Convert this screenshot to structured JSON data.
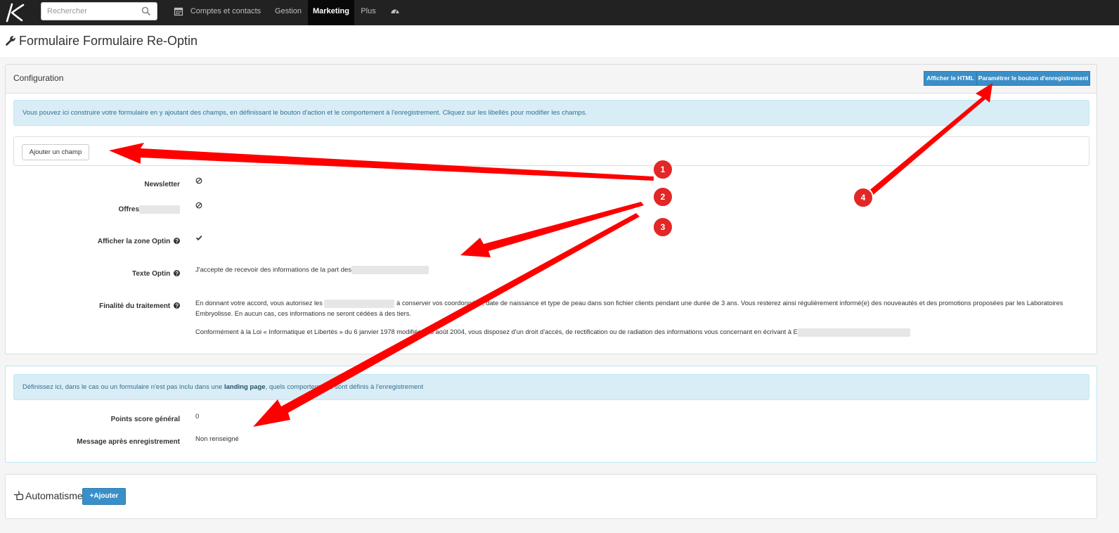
{
  "nav": {
    "search_placeholder": "Rechercher",
    "items": [
      {
        "label": "Comptes et contacts"
      },
      {
        "label": "Gestion"
      },
      {
        "label": "Marketing"
      },
      {
        "label": "Plus"
      }
    ]
  },
  "page": {
    "title": "Formulaire Formulaire Re-Optin"
  },
  "config": {
    "heading": "Configuration",
    "btn_html": "Afficher le HTML",
    "btn_param": "Paramétrer le bouton d'enregistrement",
    "info": "Vous pouvez ici construire votre formulaire en y ajoutant des champs, en définissant le bouton d'action et le comportement à l'enregistrement. Cliquez sur les libellés pour modifier les champs.",
    "add_field": "Ajouter un champ",
    "fields": [
      {
        "label": "Newsletter"
      },
      {
        "label": "Offres"
      },
      {
        "label": "Afficher la zone Optin"
      },
      {
        "label": "Texte Optin",
        "value": "J'accepte de recevoir des informations de la part des"
      },
      {
        "label": "Finalité du traitement",
        "p1_a": "En donnant votre accord, vous autorisez les",
        "p1_b": "à conserver vos coordonnées, date de naissance et type de peau dans son fichier clients pendant une durée de 3 ans. Vous resterez ainsi régulièrement informé(e) des nouveautés et des promotions proposées par les",
        "p1_c": "Laboratoires Embryolisse. En aucun cas, ces informations ne seront cédées à des tiers.",
        "p2_a": "Conformément à la Loi « Informatique et Libertés » du 6 janvier 1978 modifiée le 6 août 2004, vous disposez d'un droit d'accès, de rectification ou de radiation des informations vous concernant en écrivant à E"
      }
    ]
  },
  "behaviour": {
    "info_a": "Définissez ici, dans le cas ou un formulaire n'est pas inclu dans une ",
    "info_link": "landing page",
    "info_b": ", quels comportements sont définis à l'enregistrement",
    "fields": [
      {
        "label": "Points score général",
        "value": "0"
      },
      {
        "label": "Message après enregistrement",
        "value": "Non renseigné"
      }
    ]
  },
  "automations": {
    "heading": "Automatismes",
    "add": "Ajouter"
  },
  "annotations": [
    {
      "number": "1"
    },
    {
      "number": "2"
    },
    {
      "number": "3"
    },
    {
      "number": "4"
    }
  ],
  "colors": {
    "navbar": "#222222",
    "primary": "#3a8fc8",
    "info_bg": "#d9edf7",
    "arrow": "#ff0000",
    "badge": "#e32626"
  }
}
